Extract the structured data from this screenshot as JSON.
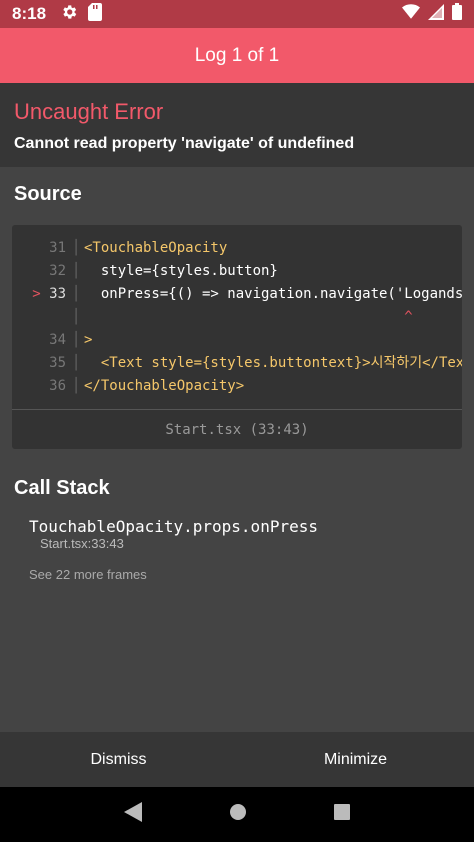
{
  "status_bar": {
    "time": "8:18",
    "icons": [
      "gear-icon",
      "sd-card-icon",
      "wifi-icon",
      "signal-icon",
      "battery-icon"
    ]
  },
  "header": {
    "title": "Log 1 of 1"
  },
  "error": {
    "title": "Uncaught Error",
    "message": "Cannot read property 'navigate' of undefined"
  },
  "source": {
    "title": "Source",
    "lines": [
      {
        "num": "31",
        "code": "<TouchableOpacity"
      },
      {
        "num": "32",
        "code": "  style={styles.button}"
      },
      {
        "num": "33",
        "marker": ">",
        "code": "  onPress={() => navigation.navigate('Logandsi"
      },
      {
        "num": "",
        "code": "                                      ^"
      },
      {
        "num": "34",
        "code": ">"
      },
      {
        "num": "35",
        "code": "  <Text style={styles.buttontext}>시작하기</Text"
      },
      {
        "num": "36",
        "code": "</TouchableOpacity>"
      }
    ],
    "file": "Start.tsx (33:43)"
  },
  "call_stack": {
    "title": "Call Stack",
    "frames": [
      {
        "method": "TouchableOpacity.props.onPress",
        "location": "Start.tsx:33:43"
      }
    ],
    "more_frames": "See 22 more frames"
  },
  "footer": {
    "dismiss_label": "Dismiss",
    "minimize_label": "Minimize"
  },
  "nav_bar": {
    "icons": [
      "back-icon",
      "home-icon",
      "recents-icon"
    ]
  },
  "colors": {
    "accent": "#f2596a",
    "status_bar": "#b03a46",
    "panel_dark": "#363636",
    "background": "#444444",
    "code_background": "#333333"
  }
}
